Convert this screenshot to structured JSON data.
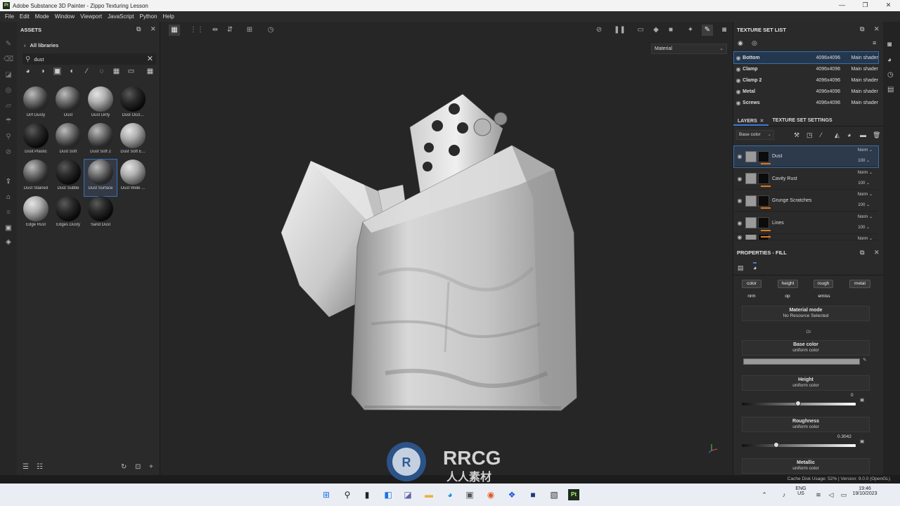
{
  "window": {
    "app_icon": "Pt",
    "title": "Adobe Substance 3D Painter - Zippo Texturing Lesson"
  },
  "menu": [
    "File",
    "Edit",
    "Mode",
    "Window",
    "Viewport",
    "JavaScript",
    "Python",
    "Help"
  ],
  "assets": {
    "title": "ASSETS",
    "library": "All libraries",
    "search_value": "dust",
    "tiles": [
      {
        "label": "Dirt Dusty",
        "tone": "mid"
      },
      {
        "label": "Dust",
        "tone": "mid"
      },
      {
        "label": "Dust Dirty",
        "tone": "light"
      },
      {
        "label": "Dust Occl...",
        "tone": "dark"
      },
      {
        "label": "Dust Plastic",
        "tone": "dark"
      },
      {
        "label": "Dust Soft",
        "tone": "mid"
      },
      {
        "label": "Dust Soft 2",
        "tone": "mid"
      },
      {
        "label": "Dust Soft E...",
        "tone": "light"
      },
      {
        "label": "Dust Stained",
        "tone": "mid"
      },
      {
        "label": "Dust Subtle",
        "tone": "dark"
      },
      {
        "label": "Dust Surface",
        "tone": "mid",
        "selected": true
      },
      {
        "label": "Dust Wide ...",
        "tone": "light"
      },
      {
        "label": "Edge Rust",
        "tone": "light"
      },
      {
        "label": "Edges Dusty",
        "tone": "dark"
      },
      {
        "label": "Sand Dust",
        "tone": "dark"
      }
    ]
  },
  "viewport": {
    "material_select": "Material"
  },
  "texture_set_list": {
    "title": "TEXTURE SET LIST",
    "rows": [
      {
        "name": "Bottom",
        "res": "4096x4096",
        "shader": "Main shader"
      },
      {
        "name": "Clamp",
        "res": "4096x4096",
        "shader": "Main shader"
      },
      {
        "name": "Clamp 2",
        "res": "4096x4096",
        "shader": "Main shader"
      },
      {
        "name": "Metal",
        "res": "4096x4096",
        "shader": "Main shader"
      },
      {
        "name": "Screws",
        "res": "4096x4096",
        "shader": "Main shader"
      }
    ]
  },
  "layers": {
    "tab_layers": "LAYERS",
    "tab_tss": "TEXTURE SET SETTINGS",
    "channel": "Base color",
    "items": [
      {
        "name": "Dust",
        "blend": "Norm",
        "opacity": "100"
      },
      {
        "name": "Cavity Rust",
        "blend": "Norm",
        "opacity": "100"
      },
      {
        "name": "Grunge Scratches",
        "blend": "Norm",
        "opacity": "100"
      },
      {
        "name": "Lines",
        "blend": "Norm",
        "opacity": "100"
      },
      {
        "name": "",
        "blend": "Norm",
        "opacity": ""
      }
    ]
  },
  "properties": {
    "title": "PROPERTIES - FILL",
    "channels": [
      "color",
      "height",
      "rough",
      "metal",
      "nrm",
      "op",
      "emiss"
    ],
    "material_mode": "Material mode",
    "no_resource": "No Resource Selected",
    "or": "Or",
    "base_color": "Base color",
    "uniform": "uniform color",
    "height": "Height",
    "height_value": "0",
    "roughness": "Roughness",
    "roughness_value": "0.3042",
    "metallic": "Metallic"
  },
  "status": "Cache Disk Usage:   52%  |  Version: 9.0.0 (OpenGL)",
  "taskbar": {
    "lang": "ENG",
    "region": "US",
    "time": "19:46",
    "date": "19/10/2023"
  },
  "watermark": {
    "text": "RRCG",
    "sub": "人人素材"
  }
}
